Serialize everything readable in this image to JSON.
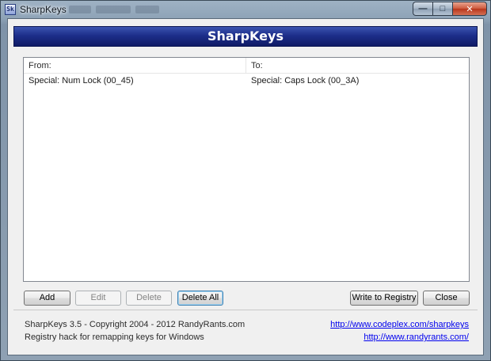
{
  "window": {
    "title": "SharpKeys",
    "icon_name": "sharpkeys-app-icon",
    "icon_glyph": "Sk"
  },
  "caption_buttons": {
    "minimize_glyph": "—",
    "maximize_glyph": "□",
    "close_glyph": "✕"
  },
  "banner": {
    "title": "SharpKeys"
  },
  "list": {
    "columns": [
      "From:",
      "To:"
    ],
    "rows": [
      {
        "from": "Special: Num Lock (00_45)",
        "to": "Special: Caps Lock (00_3A)"
      }
    ]
  },
  "buttons": {
    "add": "Add",
    "edit": "Edit",
    "delete": "Delete",
    "delete_all": "Delete All",
    "write_registry": "Write to Registry",
    "close": "Close"
  },
  "footer": {
    "copyright": "SharpKeys 3.5 - Copyright 2004 - 2012 RandyRants.com",
    "description": "Registry hack for remapping keys for Windows",
    "link1": "http://www.codeplex.com/sharpkeys",
    "link2": "http://www.randyrants.com/"
  },
  "colors": {
    "banner_top": "#3b54b0",
    "banner_bottom": "#0f1b66",
    "link": "#0000ee",
    "close_button_red": "#b8361c"
  }
}
